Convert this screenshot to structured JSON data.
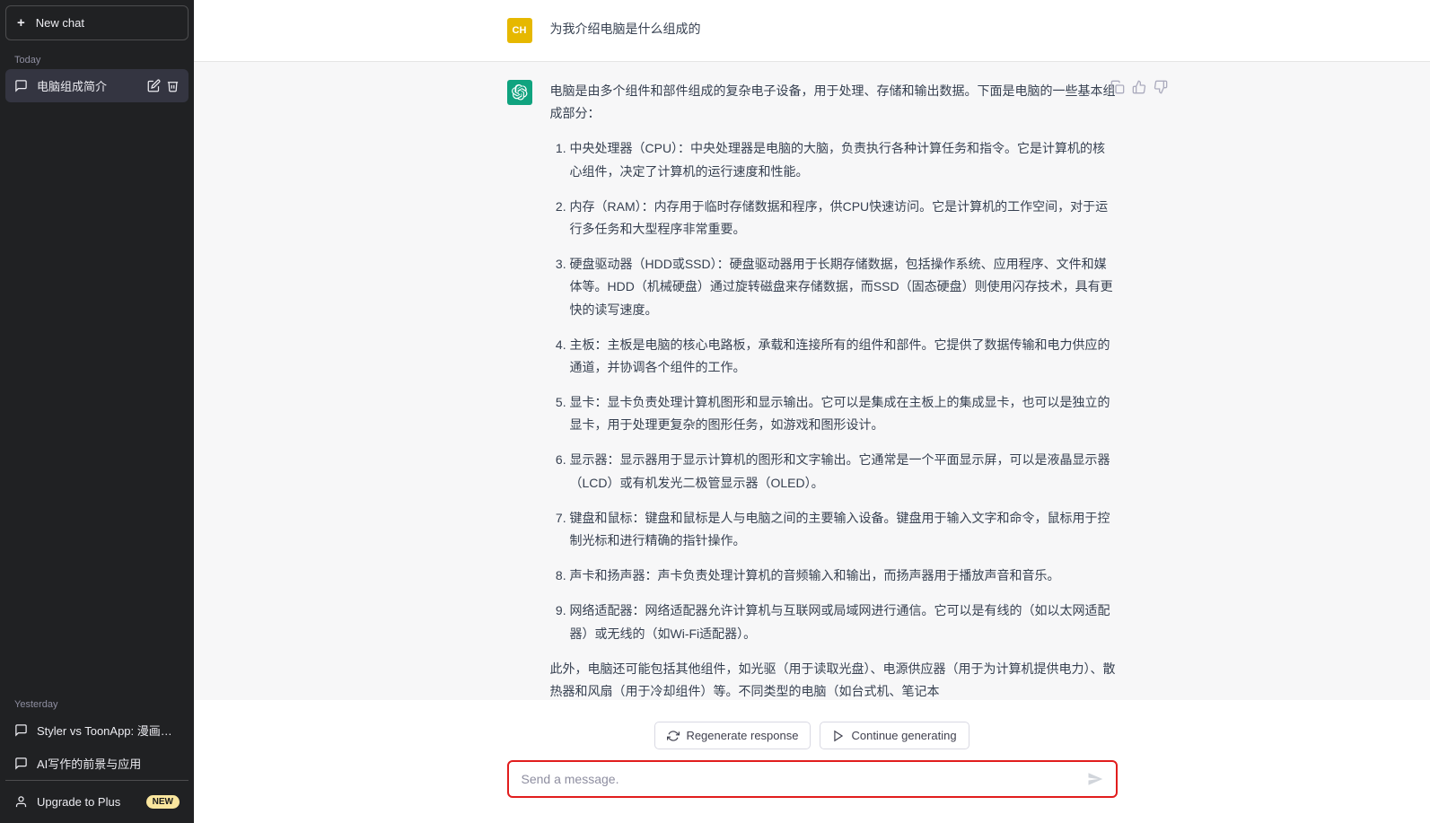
{
  "sidebar": {
    "new_chat_label": "New chat",
    "sections": {
      "today_label": "Today",
      "yesterday_label": "Yesterday"
    },
    "today_items": [
      {
        "label": "电脑组成简介",
        "active": true
      }
    ],
    "yesterday_items": [
      {
        "label": "Styler vs ToonApp: 漫画脸优劣"
      },
      {
        "label": "AI写作的前景与应用"
      }
    ],
    "upgrade_label": "Upgrade to Plus",
    "upgrade_badge": "NEW"
  },
  "conversation": {
    "user_avatar_text": "CH",
    "user_message": "为我介绍电脑是什么组成的",
    "assistant_message": {
      "intro": "电脑是由多个组件和部件组成的复杂电子设备，用于处理、存储和输出数据。下面是电脑的一些基本组成部分：",
      "items": [
        "中央处理器（CPU）：中央处理器是电脑的大脑，负责执行各种计算任务和指令。它是计算机的核心组件，决定了计算机的运行速度和性能。",
        "内存（RAM）：内存用于临时存储数据和程序，供CPU快速访问。它是计算机的工作空间，对于运行多任务和大型程序非常重要。",
        "硬盘驱动器（HDD或SSD）：硬盘驱动器用于长期存储数据，包括操作系统、应用程序、文件和媒体等。HDD（机械硬盘）通过旋转磁盘来存储数据，而SSD（固态硬盘）则使用闪存技术，具有更快的读写速度。",
        "主板：主板是电脑的核心电路板，承载和连接所有的组件和部件。它提供了数据传输和电力供应的通道，并协调各个组件的工作。",
        "显卡：显卡负责处理计算机图形和显示输出。它可以是集成在主板上的集成显卡，也可以是独立的显卡，用于处理更复杂的图形任务，如游戏和图形设计。",
        "显示器：显示器用于显示计算机的图形和文字输出。它通常是一个平面显示屏，可以是液晶显示器（LCD）或有机发光二极管显示器（OLED）。",
        "键盘和鼠标：键盘和鼠标是人与电脑之间的主要输入设备。键盘用于输入文字和命令，鼠标用于控制光标和进行精确的指针操作。",
        "声卡和扬声器：声卡负责处理计算机的音频输入和输出，而扬声器用于播放声音和音乐。",
        "网络适配器：网络适配器允许计算机与互联网或局域网进行通信。它可以是有线的（如以太网适配器）或无线的（如Wi-Fi适配器）。"
      ],
      "outro": "此外，电脑还可能包括其他组件，如光驱（用于读取光盘）、电源供应器（用于为计算机提供电力）、散热器和风扇（用于冷却组件）等。不同类型的电脑（如台式机、笔记本"
    }
  },
  "composer": {
    "regenerate_label": "Regenerate response",
    "continue_label": "Continue generating",
    "placeholder": "Send a message."
  }
}
